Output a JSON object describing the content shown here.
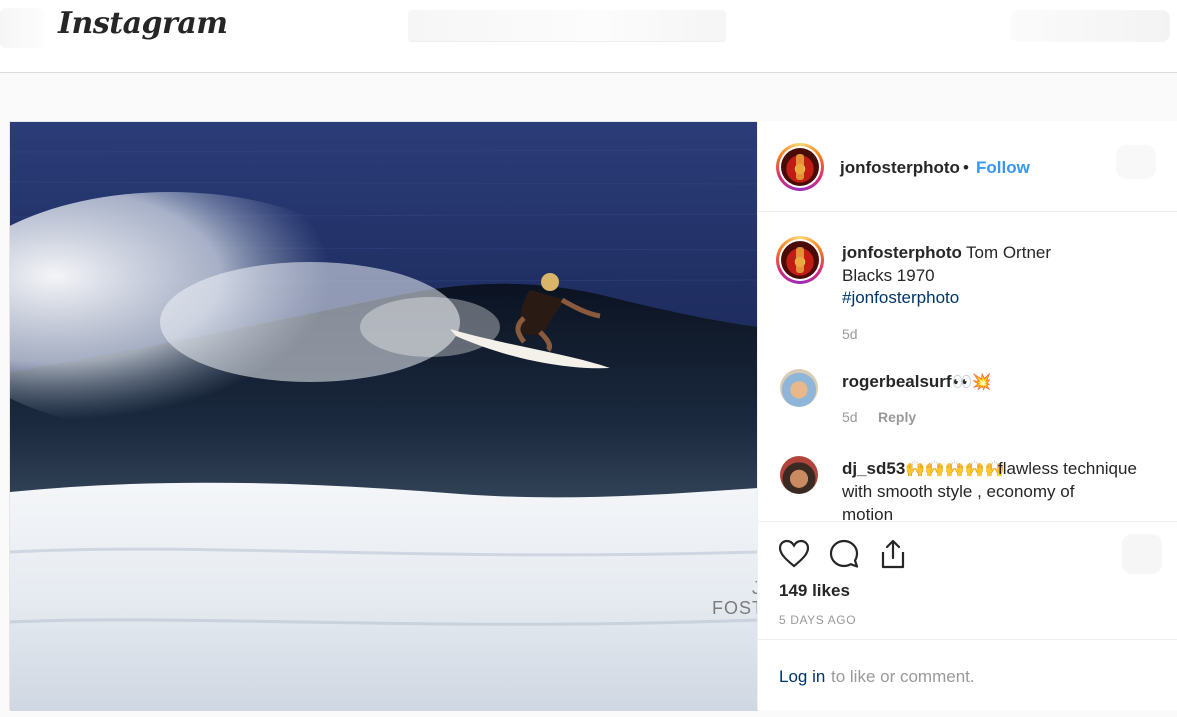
{
  "app": {
    "logo_text": "Instagram"
  },
  "post": {
    "author": "jonfosterphoto",
    "separator": "•",
    "follow_label": "Follow",
    "watermark_line1": "J",
    "watermark_line2": "FOST",
    "caption": {
      "user": "jonfosterphoto",
      "text_line1": "Tom Ortner",
      "text_line2": "Blacks 1970",
      "hashtag": "#jonfosterphoto",
      "time": "5d"
    },
    "comments": [
      {
        "user": "rogerbealsurf",
        "emoji": "👀💥",
        "time": "5d",
        "reply_label": "Reply"
      },
      {
        "user": "dj_sd53",
        "emoji": "🙌🙌🙌🙌🙌",
        "text_part1": "flawless technique",
        "text_part2": "with smooth style , economy of",
        "text_part3": "motion"
      }
    ],
    "likes": "149 likes",
    "time_ago": "5 DAYS AGO",
    "login_link": "Log in",
    "login_rest": "to like or comment."
  },
  "icons": {
    "like": "heart-icon",
    "comment": "comment-icon",
    "share": "share-icon"
  }
}
